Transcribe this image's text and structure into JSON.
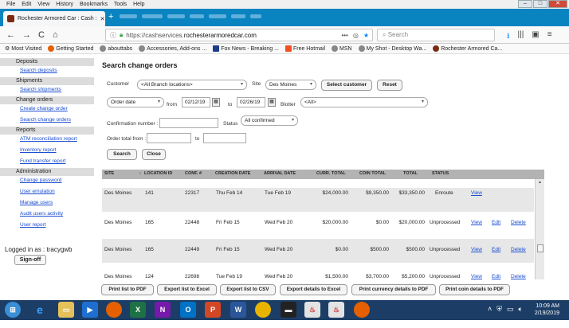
{
  "menu": [
    "File",
    "Edit",
    "View",
    "History",
    "Bookmarks",
    "Tools",
    "Help"
  ],
  "tab": {
    "title": "Rochester Armored Car : Cash :",
    "close": "✕",
    "new": "+"
  },
  "nav": {
    "back": "←",
    "forward": "→",
    "reload": "C",
    "home": "⌂"
  },
  "url": {
    "prefix": "https://cashservices.",
    "host": "rochesterarmoredcar.com",
    "more": "•••"
  },
  "search": {
    "placeholder": "Search"
  },
  "bookmarks": [
    "Most Visited",
    "Getting Started",
    "abouttabs",
    "Accessories, Add-ons ...",
    "Fox News - Breaking ...",
    "Free Hotmail",
    "MSN",
    "My Shot - Desktop Wa...",
    "Rochester Armored Ca..."
  ],
  "sidebar": {
    "sections": [
      {
        "title": "Deposits",
        "links": [
          "Search deposits"
        ]
      },
      {
        "title": "Shipments",
        "links": [
          "Search shipments"
        ]
      },
      {
        "title": "Change orders",
        "links": [
          "Create change order",
          "Search change orders"
        ]
      },
      {
        "title": "Reports",
        "links": [
          "ATM reconciliation report",
          "Inventory report",
          "Fund transfer report"
        ]
      },
      {
        "title": "Administration",
        "links": [
          "Change password",
          "User emulation",
          "Manage users",
          "Audit users activity",
          "User report"
        ]
      }
    ],
    "logged_in": "Logged in as : tracygwb",
    "sign_off": "Sign-off"
  },
  "main": {
    "title": "Search change orders",
    "customer_label": "Customer",
    "customer_value": "<All Branch locations>",
    "site_label": "Site",
    "site_value": "Des Moines",
    "select_customer": "Select customer",
    "reset": "Reset",
    "date_type": "Order date",
    "from_label": "from",
    "from_date": "02/12/19",
    "to_label": "to",
    "to_date": "02/26/19",
    "blotter_label": "Blotter",
    "blotter_value": "<All>",
    "confirmation_label": "Confirmation number :",
    "status_label": "Status",
    "status_value": "All confirmed",
    "order_total_label": "Order total from :",
    "to2_label": "to",
    "search_btn": "Search",
    "close_btn": "Close"
  },
  "grid": {
    "headers": [
      "SITE",
      "LOCATION ID",
      "CONF. #",
      "CREATION DATE",
      "ARRIVAL DATE",
      "CURR. TOTAL",
      "COIN TOTAL",
      "TOTAL",
      "STATUS"
    ],
    "rows": [
      {
        "site": "Des Moines",
        "loc": "141",
        "conf": "22317",
        "created": "Thu Feb 14",
        "arrival": "Tue Feb 19",
        "curr": "$24,000.00",
        "coin": "$9,350.00",
        "total": "$33,350.00",
        "status": "Enroute",
        "view": "View",
        "edit": "",
        "delete": ""
      },
      {
        "site": "Des Moines",
        "loc": "165",
        "conf": "22448",
        "created": "Fri Feb 15",
        "arrival": "Wed Feb 20",
        "curr": "$20,000.00",
        "coin": "$0.00",
        "total": "$20,000.00",
        "status": "Unprocessed",
        "view": "View",
        "edit": "Edit",
        "delete": "Delete"
      },
      {
        "site": "Des Moines",
        "loc": "165",
        "conf": "22449",
        "created": "Fri Feb 15",
        "arrival": "Wed Feb 20",
        "curr": "$0.00",
        "coin": "$500.00",
        "total": "$500.00",
        "status": "Unprocessed",
        "view": "View",
        "edit": "Edit",
        "delete": "Delete"
      },
      {
        "site": "Des Moines",
        "loc": "124",
        "conf": "22698",
        "created": "Tue Feb 19",
        "arrival": "Wed Feb 20",
        "curr": "$1,500.00",
        "coin": "$3,700.00",
        "total": "$5,200.00",
        "status": "Unprocessed",
        "view": "View",
        "edit": "Edit",
        "delete": "Delete"
      }
    ]
  },
  "bottom_buttons": [
    "Print list to PDF",
    "Export list to Excel",
    "Export list to CSV",
    "Export details to Excel",
    "Print currency details to PDF",
    "Print coin details to PDF"
  ],
  "taskbar": {
    "time": "10:09 AM",
    "date": "2/19/2019"
  }
}
